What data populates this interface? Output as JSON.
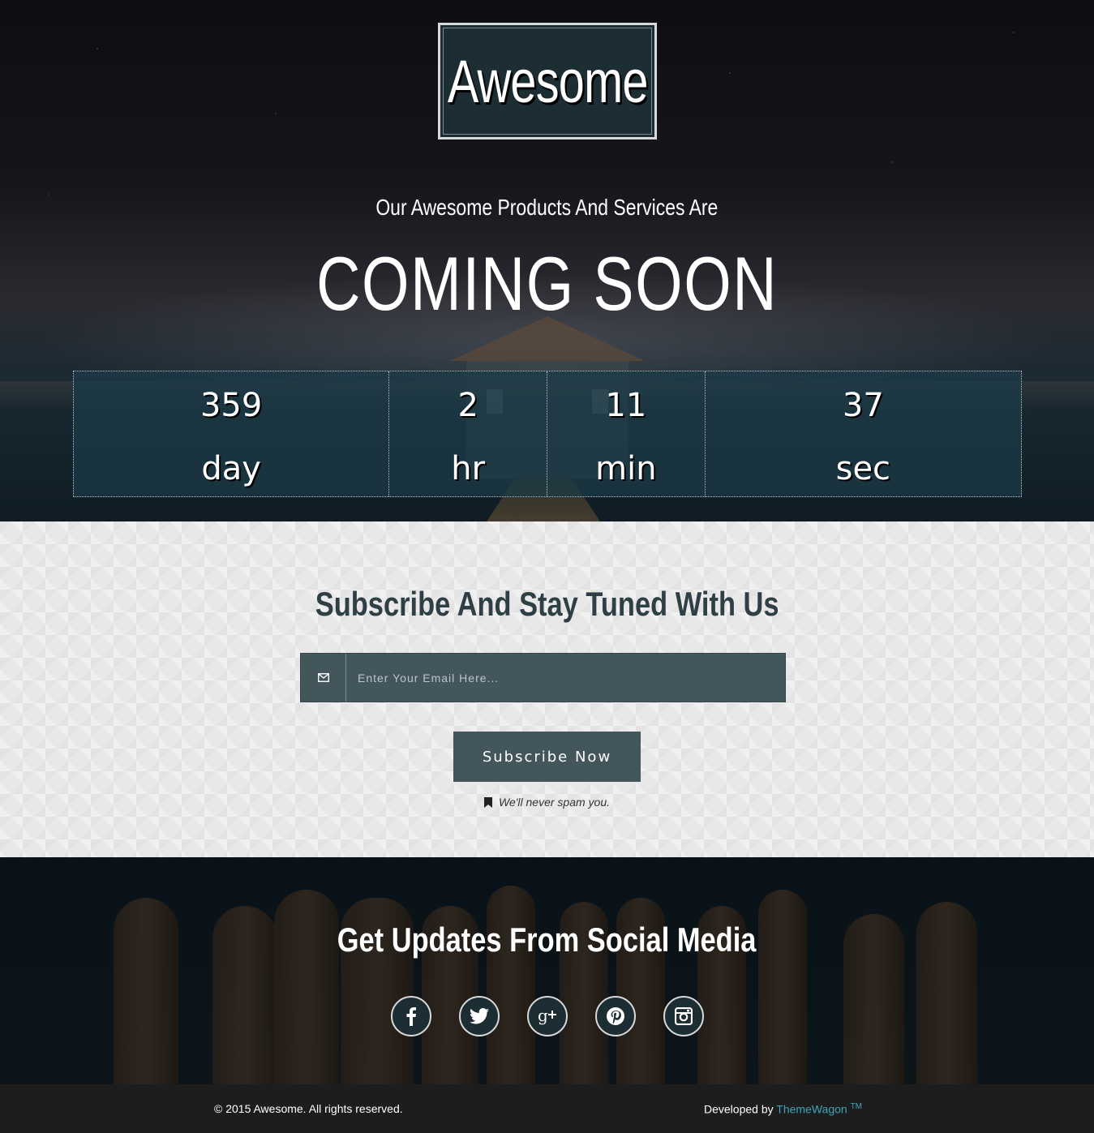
{
  "hero": {
    "logo": "Awesome",
    "tagline": "Our Awesome Products And Services Are",
    "headline": "COMING SOON",
    "countdown": [
      {
        "value": "359",
        "unit": "day"
      },
      {
        "value": "2",
        "unit": "hr"
      },
      {
        "value": "11",
        "unit": "min"
      },
      {
        "value": "37",
        "unit": "sec"
      }
    ]
  },
  "subscribe": {
    "title": "Subscribe And Stay Tuned With Us",
    "email_placeholder": "Enter Your Email Here...",
    "email_icon": "envelope-icon",
    "button_label": "Subscribe Now",
    "note": "We'll never spam you.",
    "note_icon": "bookmark-icon"
  },
  "social": {
    "title": "Get Updates From Social Media",
    "icons": [
      "facebook-icon",
      "twitter-icon",
      "google-plus-icon",
      "pinterest-icon",
      "instagram-icon"
    ]
  },
  "footer": {
    "copyright": "© 2015 Awesome. All rights reserved.",
    "developed_by": "Developed by",
    "developer": "ThemeWagon",
    "trademark": "TM"
  },
  "colors": {
    "accent": "#42565c",
    "logo_bg": "#1c2d33",
    "link": "#3fa3b8"
  }
}
